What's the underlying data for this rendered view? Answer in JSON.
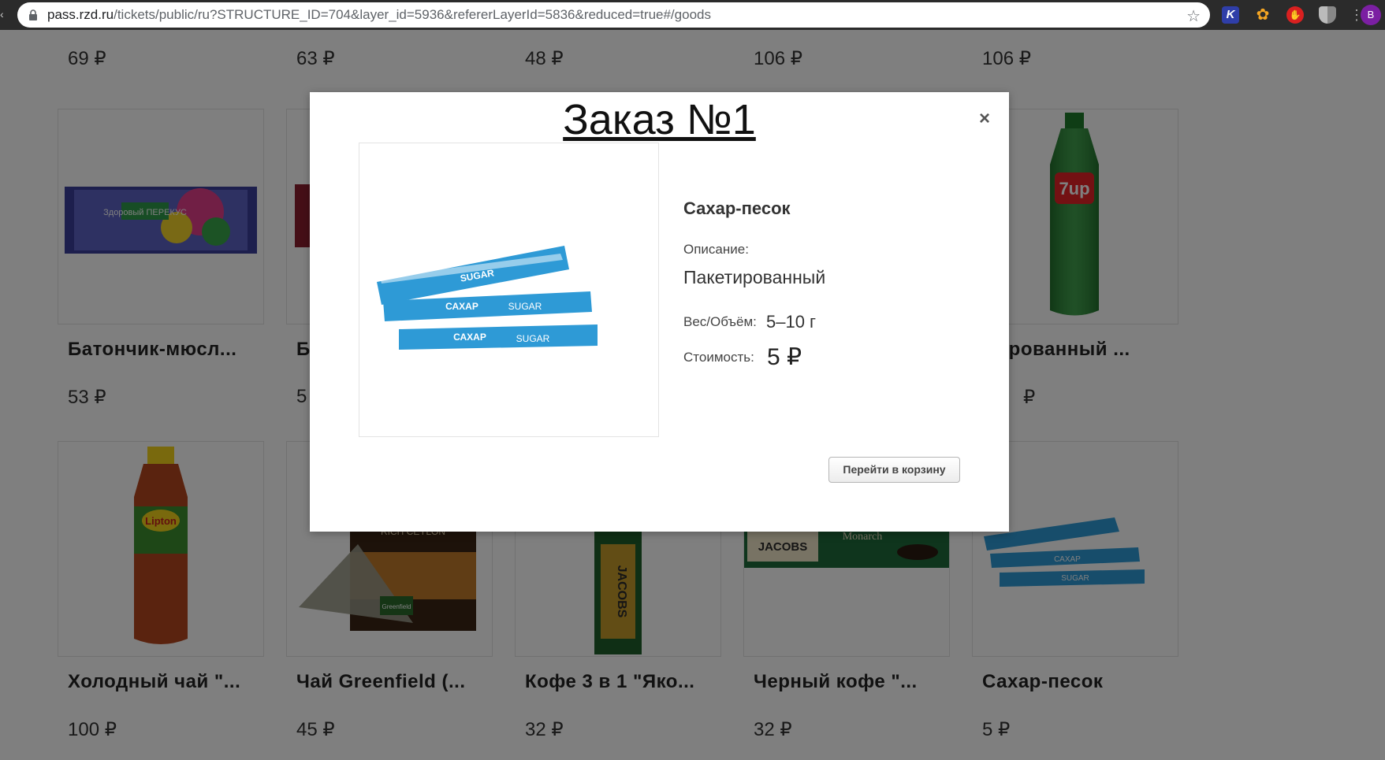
{
  "browser": {
    "url_host": "pass.rzd.ru",
    "url_path": "/tickets/public/ru?STRUCTURE_ID=704&layer_id=5936&refererLayerId=5836&reduced=true#/goods",
    "ext_k": "K",
    "avatar": "B"
  },
  "top_prices": [
    "69 ₽",
    "63 ₽",
    "48 ₽",
    "106 ₽",
    "106 ₽"
  ],
  "row2": {
    "items": [
      {
        "title": "Батончик-мюсл...",
        "price": "53 ₽"
      },
      {
        "title": "Б",
        "price": "5"
      },
      {
        "title": "",
        "price": ""
      },
      {
        "title": "",
        "price": ""
      },
      {
        "title": "зированный ...",
        "price": "₽"
      }
    ]
  },
  "row3": {
    "items": [
      {
        "title": "Холодный чай \"...",
        "price": "100 ₽"
      },
      {
        "title": "Чай Greenfield (...",
        "price": "45 ₽"
      },
      {
        "title": "Кофе 3 в 1 \"Яко...",
        "price": "32 ₽"
      },
      {
        "title": "Черный кофе \"...",
        "price": "32 ₽"
      },
      {
        "title": "Сахар-песок",
        "price": "5 ₽"
      }
    ]
  },
  "images": {
    "bar_label": "Здоровый ПЕРЕКУС",
    "lipton": "Lipton",
    "tea_label": "RICH CEYLON",
    "greenfield": "Greenfield",
    "jacobs": "JACOBS",
    "monarch": "Monarch",
    "sevenup": "7up",
    "sugar_text": "САХАР",
    "sugar_en": "SUGAR"
  },
  "modal": {
    "title": "Заказ №1",
    "close": "×",
    "product_name": "Сахар-песок",
    "description_label": "Описание:",
    "description_value": "Пакетированный",
    "weight_label": "Вес/Объём:",
    "weight_value": "5–10 г",
    "cost_label": "Стоимость:",
    "cost_value": "5 ₽",
    "cart_button": "Перейти в корзину"
  }
}
